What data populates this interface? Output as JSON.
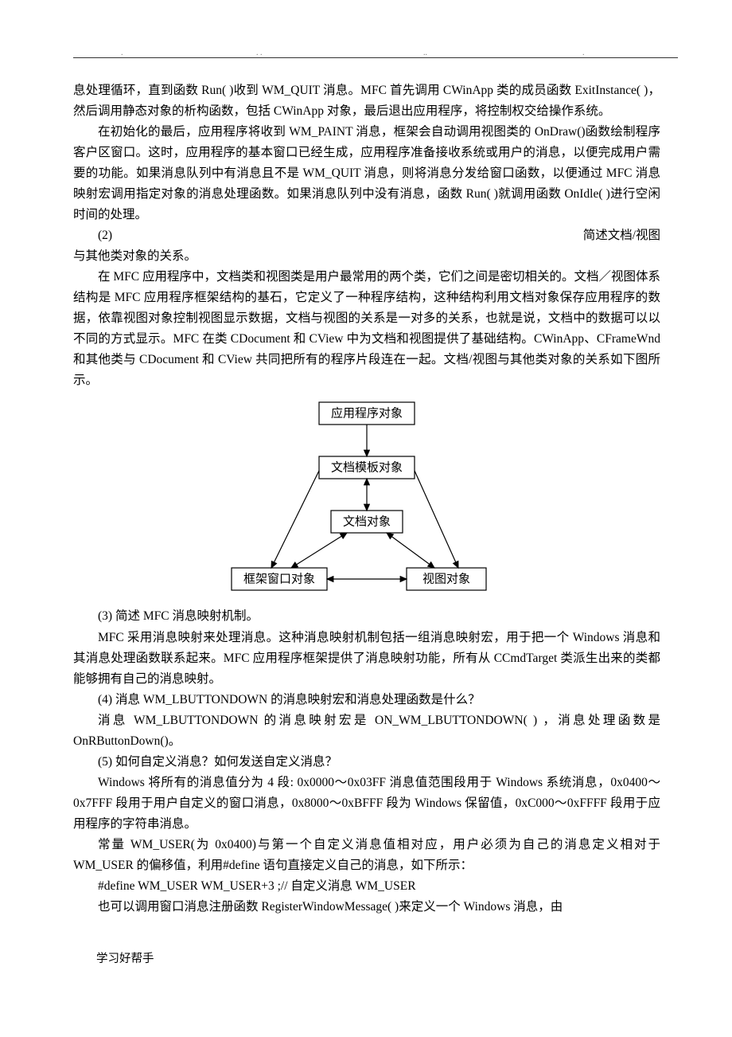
{
  "para": {
    "p1": "息处理循环，直到函数 Run( )收到 WM_QUIT 消息。MFC 首先调用 CWinApp 类的成员函数 ExitInstance( )，然后调用静态对象的析构函数，包括 CWinApp 对象，最后退出应用程序，将控制权交给操作系统。",
    "p2": "在初始化的最后，应用程序将收到 WM_PAINT 消息，框架会自动调用视图类的 OnDraw()函数绘制程序客户区窗口。这时，应用程序的基本窗口已经生成，应用程序准备接收系统或用户的消息，以便完成用户需要的功能。如果消息队列中有消息且不是 WM_QUIT 消息，则将消息分发给窗口函数，以便通过 MFC 消息映射宏调用指定对象的消息处理函数。如果消息队列中没有消息，函数 Run( )就调用函数 OnIdle( )进行空闲时间的处理。",
    "q2_left": "(2)",
    "q2_right": "简述文档/视图",
    "q2_cont": "与其他类对象的关系。",
    "p3": "在 MFC 应用程序中，文档类和视图类是用户最常用的两个类，它们之间是密切相关的。文档／视图体系结构是 MFC 应用程序框架结构的基石，它定义了一种程序结构，这种结构利用文档对象保存应用程序的数据，依靠视图对象控制视图显示数据，文档与视图的关系是一对多的关系，也就是说，文档中的数据可以以不同的方式显示。MFC 在类 CDocument 和 CView 中为文档和视图提供了基础结构。CWinApp、CFrameWnd 和其他类与 CDocument 和 CView 共同把所有的程序片段连在一起。文档/视图与其他类对象的关系如下图所示。",
    "q3": "(3) 简述 MFC 消息映射机制。",
    "p4": "MFC 采用消息映射来处理消息。这种消息映射机制包括一组消息映射宏，用于把一个 Windows 消息和其消息处理函数联系起来。MFC 应用程序框架提供了消息映射功能，所有从 CCmdTarget 类派生出来的类都能够拥有自己的消息映射。",
    "q4": "(4) 消息 WM_LBUTTONDOWN 的消息映射宏和消息处理函数是什么？",
    "p5": "消息 WM_LBUTTONDOWN 的消息映射宏是 ON_WM_LBUTTONDOWN( ) ，消息处理函数是 OnRButtonDown()。",
    "q5": "(5) 如何自定义消息？如何发送自定义消息？",
    "p6": "Windows 将所有的消息值分为 4 段: 0x0000～0x03FF 消息值范围段用于 Windows 系统消息，0x0400～0x7FFF 段用于用户自定义的窗口消息，0x8000～0xBFFF 段为 Windows 保留值，0xC000～0xFFFF 段用于应用程序的字符串消息。",
    "p7": "常量 WM_USER(为 0x0400)与第一个自定义消息值相对应，用户必须为自己的消息定义相对于 WM_USER 的偏移值，利用#define 语句直接定义自己的消息，如下所示：",
    "code": "#define   WM_USER   WM_USER+3 ;//  自定义消息 WM_USER",
    "p8": "也可以调用窗口消息注册函数 RegisterWindowMessage( )来定义一个 Windows 消息，由"
  },
  "diagram": {
    "n1": "应用程序对象",
    "n2": "文档模板对象",
    "n3": "文档对象",
    "n4": "框架窗口对象",
    "n5": "视图对象"
  },
  "footer": "学习好帮手"
}
